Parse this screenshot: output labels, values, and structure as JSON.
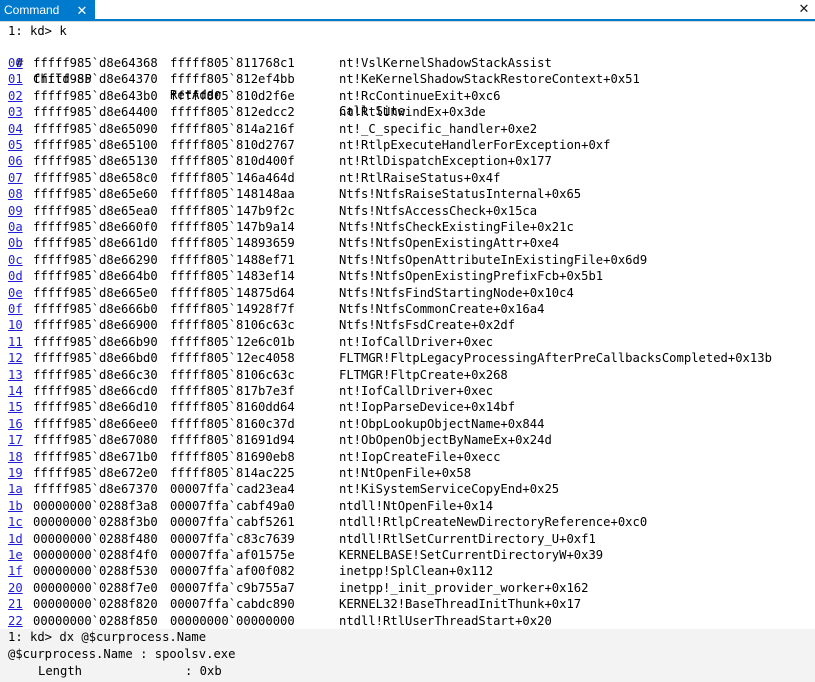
{
  "tab": {
    "title": "Command",
    "close_glyph": "✕"
  },
  "window_close_glyph": "✕",
  "command": "1: kd> k",
  "header": {
    "hash": "#",
    "child_sp": "Child-SP",
    "ret_addr": "RetAddr",
    "call_site": "Call Site"
  },
  "frames": [
    {
      "n": "00",
      "sp": "fffff985`d8e64368",
      "ret": "fffff805`811768c1",
      "call": "nt!VslKernelShadowStackAssist"
    },
    {
      "n": "01",
      "sp": "fffff985`d8e64370",
      "ret": "fffff805`812ef4bb",
      "call": "nt!KeKernelShadowStackRestoreContext+0x51"
    },
    {
      "n": "02",
      "sp": "fffff985`d8e643b0",
      "ret": "fffff805`810d2f6e",
      "call": "nt!RcContinueExit+0xc6"
    },
    {
      "n": "03",
      "sp": "fffff985`d8e64400",
      "ret": "fffff805`812edcc2",
      "call": "nt!RtlUnwindEx+0x3de"
    },
    {
      "n": "04",
      "sp": "fffff985`d8e65090",
      "ret": "fffff805`814a216f",
      "call": "nt!_C_specific_handler+0xe2"
    },
    {
      "n": "05",
      "sp": "fffff985`d8e65100",
      "ret": "fffff805`810d2767",
      "call": "nt!RtlpExecuteHandlerForException+0xf"
    },
    {
      "n": "06",
      "sp": "fffff985`d8e65130",
      "ret": "fffff805`810d400f",
      "call": "nt!RtlDispatchException+0x177"
    },
    {
      "n": "07",
      "sp": "fffff985`d8e658c0",
      "ret": "fffff805`146a464d",
      "call": "nt!RtlRaiseStatus+0x4f"
    },
    {
      "n": "08",
      "sp": "fffff985`d8e65e60",
      "ret": "fffff805`148148aa",
      "call": "Ntfs!NtfsRaiseStatusInternal+0x65"
    },
    {
      "n": "09",
      "sp": "fffff985`d8e65ea0",
      "ret": "fffff805`147b9f2c",
      "call": "Ntfs!NtfsAccessCheck+0x15ca"
    },
    {
      "n": "0a",
      "sp": "fffff985`d8e660f0",
      "ret": "fffff805`147b9a14",
      "call": "Ntfs!NtfsCheckExistingFile+0x21c"
    },
    {
      "n": "0b",
      "sp": "fffff985`d8e661d0",
      "ret": "fffff805`14893659",
      "call": "Ntfs!NtfsOpenExistingAttr+0xe4"
    },
    {
      "n": "0c",
      "sp": "fffff985`d8e66290",
      "ret": "fffff805`1488ef71",
      "call": "Ntfs!NtfsOpenAttributeInExistingFile+0x6d9"
    },
    {
      "n": "0d",
      "sp": "fffff985`d8e664b0",
      "ret": "fffff805`1483ef14",
      "call": "Ntfs!NtfsOpenExistingPrefixFcb+0x5b1"
    },
    {
      "n": "0e",
      "sp": "fffff985`d8e665e0",
      "ret": "fffff805`14875d64",
      "call": "Ntfs!NtfsFindStartingNode+0x10c4"
    },
    {
      "n": "0f",
      "sp": "fffff985`d8e666b0",
      "ret": "fffff805`14928f7f",
      "call": "Ntfs!NtfsCommonCreate+0x16a4"
    },
    {
      "n": "10",
      "sp": "fffff985`d8e66900",
      "ret": "fffff805`8106c63c",
      "call": "Ntfs!NtfsFsdCreate+0x2df"
    },
    {
      "n": "11",
      "sp": "fffff985`d8e66b90",
      "ret": "fffff805`12e6c01b",
      "call": "nt!IofCallDriver+0xec"
    },
    {
      "n": "12",
      "sp": "fffff985`d8e66bd0",
      "ret": "fffff805`12ec4058",
      "call": "FLTMGR!FltpLegacyProcessingAfterPreCallbacksCompleted+0x13b"
    },
    {
      "n": "13",
      "sp": "fffff985`d8e66c30",
      "ret": "fffff805`8106c63c",
      "call": "FLTMGR!FltpCreate+0x268"
    },
    {
      "n": "14",
      "sp": "fffff985`d8e66cd0",
      "ret": "fffff805`817b7e3f",
      "call": "nt!IofCallDriver+0xec"
    },
    {
      "n": "15",
      "sp": "fffff985`d8e66d10",
      "ret": "fffff805`8160dd64",
      "call": "nt!IopParseDevice+0x14bf"
    },
    {
      "n": "16",
      "sp": "fffff985`d8e66ee0",
      "ret": "fffff805`8160c37d",
      "call": "nt!ObpLookupObjectName+0x844"
    },
    {
      "n": "17",
      "sp": "fffff985`d8e67080",
      "ret": "fffff805`81691d94",
      "call": "nt!ObOpenObjectByNameEx+0x24d"
    },
    {
      "n": "18",
      "sp": "fffff985`d8e671b0",
      "ret": "fffff805`81690eb8",
      "call": "nt!IopCreateFile+0xecc"
    },
    {
      "n": "19",
      "sp": "fffff985`d8e672e0",
      "ret": "fffff805`814ac225",
      "call": "nt!NtOpenFile+0x58"
    },
    {
      "n": "1a",
      "sp": "fffff985`d8e67370",
      "ret": "00007ffa`cad23ea4",
      "call": "nt!KiSystemServiceCopyEnd+0x25"
    },
    {
      "n": "1b",
      "sp": "00000000`0288f3a8",
      "ret": "00007ffa`cabf49a0",
      "call": "ntdll!NtOpenFile+0x14"
    },
    {
      "n": "1c",
      "sp": "00000000`0288f3b0",
      "ret": "00007ffa`cabf5261",
      "call": "ntdll!RtlpCreateNewDirectoryReference+0xc0"
    },
    {
      "n": "1d",
      "sp": "00000000`0288f480",
      "ret": "00007ffa`c83c7639",
      "call": "ntdll!RtlSetCurrentDirectory_U+0xf1"
    },
    {
      "n": "1e",
      "sp": "00000000`0288f4f0",
      "ret": "00007ffa`af01575e",
      "call": "KERNELBASE!SetCurrentDirectoryW+0x39"
    },
    {
      "n": "1f",
      "sp": "00000000`0288f530",
      "ret": "00007ffa`af00f082",
      "call": "inetpp!SplClean+0x112"
    },
    {
      "n": "20",
      "sp": "00000000`0288f7e0",
      "ret": "00007ffa`c9b755a7",
      "call": "inetpp!_init_provider_worker+0x162"
    },
    {
      "n": "21",
      "sp": "00000000`0288f820",
      "ret": "00007ffa`cabdc890",
      "call": "KERNEL32!BaseThreadInitThunk+0x17"
    },
    {
      "n": "22",
      "sp": "00000000`0288f850",
      "ret": "00000000`00000000",
      "call": "ntdll!RtlUserThreadStart+0x20"
    }
  ],
  "bottom": {
    "command": "1: kd> dx @$curprocess.Name",
    "result": "@$curprocess.Name : spoolsv.exe",
    "length_label": "Length",
    "length_value": ": 0xb"
  }
}
